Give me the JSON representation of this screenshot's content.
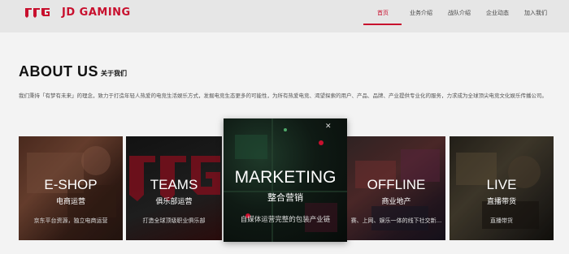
{
  "brand": {
    "name": "JD GAMING",
    "accent": "#c8102e"
  },
  "nav": {
    "items": [
      {
        "label": "首页",
        "active": true
      },
      {
        "label": "业务介绍",
        "active": false
      },
      {
        "label": "战队介绍",
        "active": false
      },
      {
        "label": "企业动态",
        "active": false
      },
      {
        "label": "加入我们",
        "active": false
      }
    ]
  },
  "about": {
    "title": "ABOUT US",
    "subtitle": "关于我们",
    "description": "我们秉持「有梦有未来」的理念，致力于打造年轻人热爱的电竞生活娱乐方式，发掘电竞生态更多的可能性，为所有热爱电竞、渴望探索的用户、产品、品牌、产业提供专业化的服务，力求成为全球顶尖电竞文化娱乐传播公司。"
  },
  "cards": [
    {
      "title": "E-SHOP",
      "subtitle": "电商运营",
      "description": "京东平台资源，独立电商运营"
    },
    {
      "title": "TEAMS",
      "subtitle": "俱乐部运营",
      "description": "打造全球顶级职业俱乐部"
    },
    {
      "title": "MARKETING",
      "subtitle": "整合营销",
      "description": "自媒体运营完整的包装产业链"
    },
    {
      "title": "OFFLINE",
      "subtitle": "商业地产",
      "description": "赛、上网、娱乐一体的线下社交新..."
    },
    {
      "title": "LIVE",
      "subtitle": "直播带货",
      "description": "直播带货"
    }
  ]
}
